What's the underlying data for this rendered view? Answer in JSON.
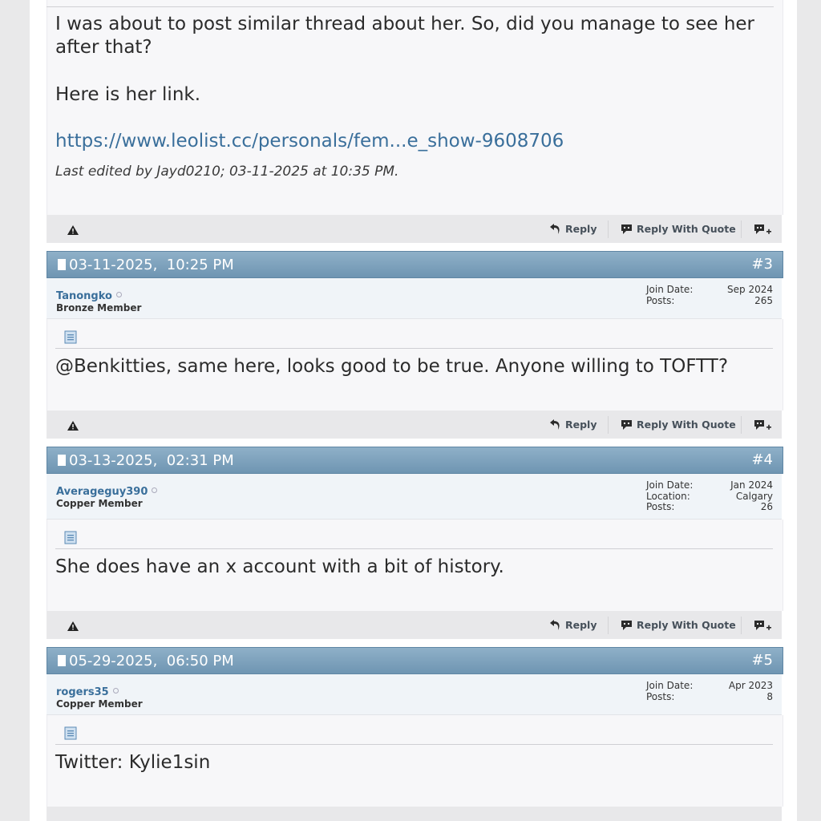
{
  "post2": {
    "text_line1": "I was about to post similar thread about her. So, did you manage to see her",
    "text_line2": "after that?",
    "text_line3": "Here is her link.",
    "link": "https://www.leolist.cc/personals/fem...e_show-9608706",
    "edited": "Last edited by Jayd0210; 03-11-2025 at 10:35 PM."
  },
  "actions": {
    "reply": "Reply",
    "reply_quote": "Reply With Quote"
  },
  "post3": {
    "date": "03-11-2025,  10:25 PM",
    "num": "#3",
    "user": "Tanongko",
    "rank": "Bronze Member",
    "labels": [
      "Join Date:",
      "Posts:"
    ],
    "values": [
      "Sep 2024",
      "265"
    ],
    "text": "@Benkitties, same here, looks good to be true. Anyone willing to TOFTT?"
  },
  "post4": {
    "date": "03-13-2025,  02:31 PM",
    "num": "#4",
    "user": "Averageguy390",
    "rank": "Copper Member",
    "labels": [
      "Join Date:",
      "Location:",
      "Posts:"
    ],
    "values": [
      "Jan 2024",
      "Calgary",
      "26"
    ],
    "text": "She does have an x account with a bit of history."
  },
  "post5": {
    "date": "05-29-2025,  06:50 PM",
    "num": "#5",
    "user": "rogers35",
    "rank": "Copper Member",
    "labels": [
      "Join Date:",
      "Posts:"
    ],
    "values": [
      "Apr 2023",
      "8"
    ],
    "text": "Twitter: Kylie1sin"
  },
  "icons": [
    "warning-icon",
    "reply-arrow-icon",
    "quote-icon",
    "multiquote-icon",
    "post-document-icon"
  ],
  "colors": {
    "header": "#7b9fba",
    "link": "#3a6f9b",
    "body_bg": "#f7f7f9"
  }
}
